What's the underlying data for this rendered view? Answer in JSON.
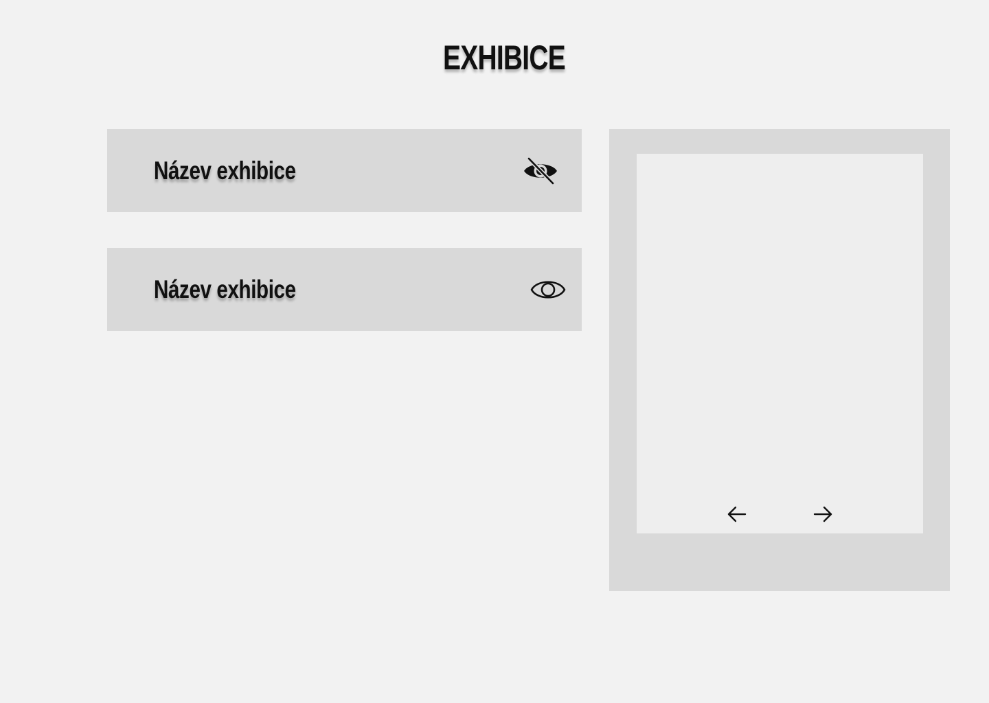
{
  "page": {
    "title": "EXHIBICE",
    "background_color": "#f2f2f2"
  },
  "exhibits": [
    {
      "name": "Název exhibice",
      "visibility_icon": "eye-off-icon",
      "visible": false
    },
    {
      "name": "Název exhibice",
      "visibility_icon": "eye-icon",
      "visible": true
    }
  ],
  "preview": {
    "prev_icon": "arrow-left-icon",
    "next_icon": "arrow-right-icon"
  },
  "colors": {
    "card": "#d9d9d9",
    "frame": "#eeeeee",
    "text": "#111111"
  }
}
